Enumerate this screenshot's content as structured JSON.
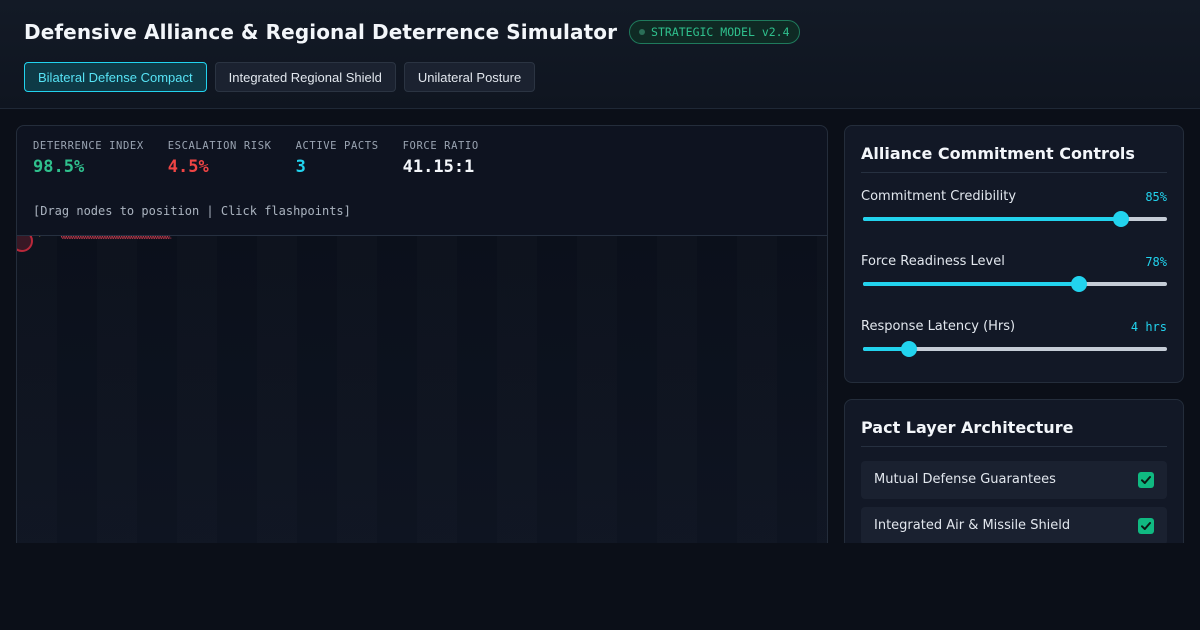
{
  "header": {
    "title": "Defensive Alliance & Regional Deterrence Simulator",
    "badge": "STRATEGIC MODEL v2.4"
  },
  "scenarios": [
    {
      "label": "Bilateral Defense Compact",
      "active": true
    },
    {
      "label": "Integrated Regional Shield",
      "active": false
    },
    {
      "label": "Unilateral Posture",
      "active": false
    }
  ],
  "metrics": {
    "deterrence": {
      "label": "DETERRENCE INDEX",
      "value": "98.5%",
      "color": "#2fc08d"
    },
    "escalation": {
      "label": "ESCALATION RISK",
      "value": "4.5%",
      "color": "#ef4444"
    },
    "pacts": {
      "label": "ACTIVE PACTS",
      "value": "3",
      "color": "#22d3ee"
    },
    "force": {
      "label": "FORCE RATIO",
      "value": "41.15:1",
      "color": "#f3f6fa"
    }
  },
  "hint": "[Drag nodes to position | Click flashpoints]",
  "controls": {
    "title": "Alliance Commitment Controls",
    "sliders": [
      {
        "label": "Commitment Credibility",
        "value_text": "85%",
        "fraction": 0.85
      },
      {
        "label": "Force Readiness Level",
        "value_text": "78%",
        "fraction": 0.71
      },
      {
        "label": "Response Latency (Hrs)",
        "value_text": "4 hrs",
        "fraction": 0.15
      }
    ]
  },
  "pacts": {
    "title": "Pact Layer Architecture",
    "items": [
      {
        "label": "Mutual Defense Guarantees",
        "checked": true
      },
      {
        "label": "Integrated Air & Missile Shield",
        "checked": true
      }
    ]
  },
  "colors": {
    "accent": "#22d3ee",
    "success": "#10b981",
    "danger": "#ef4444"
  }
}
